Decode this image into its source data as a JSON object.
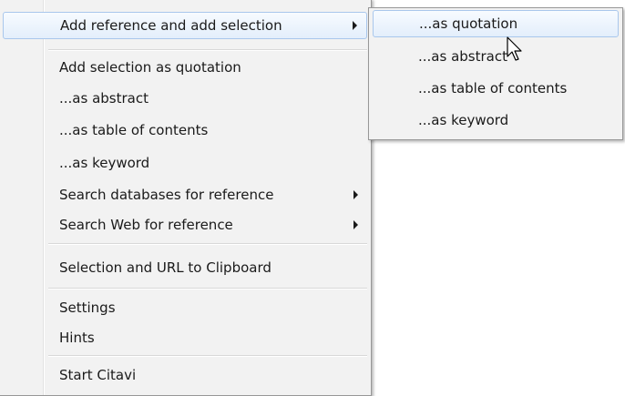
{
  "main_menu": {
    "items": [
      {
        "label": "Add reference and add selection",
        "has_submenu": true,
        "highlighted": true
      },
      {
        "label": "Add selection as quotation"
      },
      {
        "label": "...as abstract"
      },
      {
        "label": "...as table of contents"
      },
      {
        "label": "...as keyword"
      },
      {
        "label": "Search databases for reference",
        "has_submenu": true
      },
      {
        "label": "Search Web for reference",
        "has_submenu": true
      },
      {
        "label": "Selection and URL to Clipboard"
      },
      {
        "label": "Settings"
      },
      {
        "label": "Hints"
      },
      {
        "label": "Start Citavi"
      }
    ]
  },
  "submenu": {
    "items": [
      {
        "label": "...as quotation",
        "highlighted": true
      },
      {
        "label": "...as abstract"
      },
      {
        "label": "...as table of contents"
      },
      {
        "label": "...as keyword"
      }
    ]
  },
  "colors": {
    "menu_background": "#f2f2f2",
    "highlight_border": "#a9c7ec",
    "highlight_fill": "#e3eefb"
  },
  "icons": [
    "submenu-arrow-icon",
    "mouse-pointer-icon"
  ]
}
